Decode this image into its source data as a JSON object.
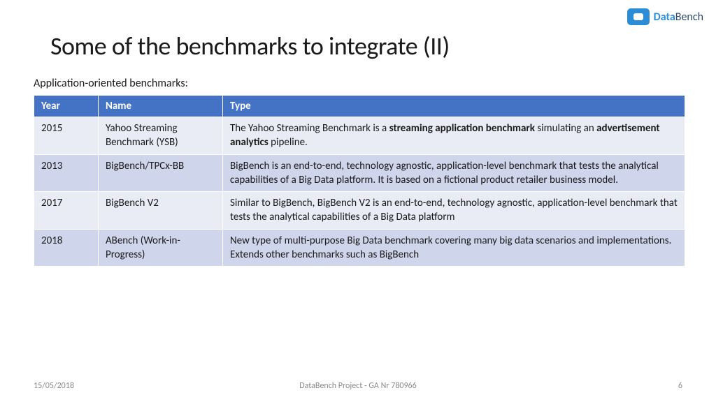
{
  "logo": {
    "primary": "Data",
    "suffix": "Bench"
  },
  "title": "Some of the benchmarks to integrate (II)",
  "subtitle": "Application-oriented benchmarks:",
  "table": {
    "headers": [
      "Year",
      "Name",
      "Type"
    ],
    "rows": [
      {
        "year": "2015",
        "name": "Yahoo Streaming Benchmark  (YSB)",
        "type_html": "The Yahoo Streaming Benchmark is a <b>streaming application benchmark</b> simulating an <b>advertisement analytics</b> pipeline."
      },
      {
        "year": "2013",
        "name": "BigBench/TPCx-BB",
        "type_html": "BigBench is an end-to-end, technology agnostic, application-level benchmark that tests the analytical capabilities of a Big Data platform. It is based on a fictional product retailer business model."
      },
      {
        "year": "2017",
        "name": "BigBench V2",
        "type_html": "Similar to BigBench, BigBench V2 is an end-to-end, technology agnostic, application-level benchmark that tests the analytical capabilities of a Big Data platform"
      },
      {
        "year": "2018",
        "name": "ABench (Work-in-Progress)",
        "type_html": "New type of  multi-purpose Big Data benchmark covering many big data scenarios and implementations. Extends other benchmarks such as BigBench"
      }
    ]
  },
  "footer": {
    "date": "15/05/2018",
    "project": "DataBench Project - GA Nr 780966",
    "page": "6"
  }
}
